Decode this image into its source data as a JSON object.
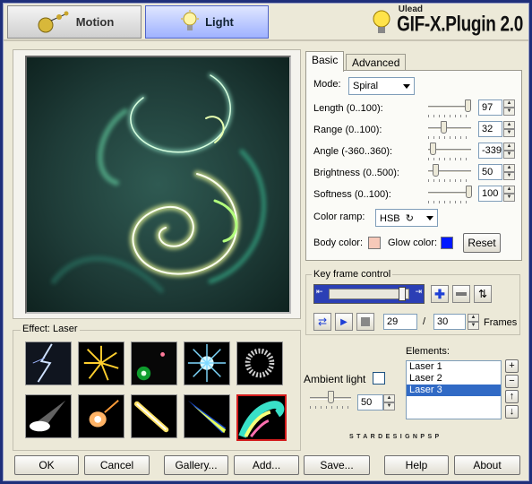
{
  "top_tabs": {
    "motion": "Motion",
    "light": "Light"
  },
  "brand": {
    "company": "Ulead",
    "product": "GIF-X.Plugin 2.0"
  },
  "effect": {
    "label": "Effect: Laser"
  },
  "tabs": {
    "basic": "Basic",
    "advanced": "Advanced"
  },
  "basic": {
    "mode_label": "Mode:",
    "mode_value": "Spiral",
    "length_label": "Length (0..100):",
    "length_value": "97",
    "range_label": "Range (0..100):",
    "range_value": "32",
    "angle_label": "Angle (-360..360):",
    "angle_value": "-339",
    "brightness_label": "Brightness (0..500):",
    "brightness_value": "50",
    "softness_label": "Softness (0..100):",
    "softness_value": "100",
    "color_ramp_label": "Color ramp:",
    "color_ramp_value": "HSB",
    "body_color_label": "Body color:",
    "body_color": "#f7c9b9",
    "glow_color_label": "Glow color:",
    "glow_color": "#0018ff",
    "reset_label": "Reset"
  },
  "keyframe": {
    "label": "Key frame control",
    "current_frame": "29",
    "slash": "/",
    "total_frames": "30",
    "frames_label": "Frames"
  },
  "elements": {
    "label": "Elements:",
    "items": [
      "Laser 1",
      "Laser 2",
      "Laser 3"
    ],
    "selected_index": 2,
    "side_buttons": [
      "+",
      "−",
      "↑",
      "↓"
    ]
  },
  "ambient": {
    "label": "Ambient light",
    "value": "50"
  },
  "watermark": "STARDESIGNPSP",
  "buttons": {
    "ok": "OK",
    "cancel": "Cancel",
    "gallery": "Gallery...",
    "add": "Add...",
    "save": "Save...",
    "help": "Help",
    "about": "About"
  },
  "colors": {
    "accent_selected": "#316ac5",
    "thumb_selected_border": "#d41d1d",
    "outer_bg": "#1f2f7a"
  }
}
